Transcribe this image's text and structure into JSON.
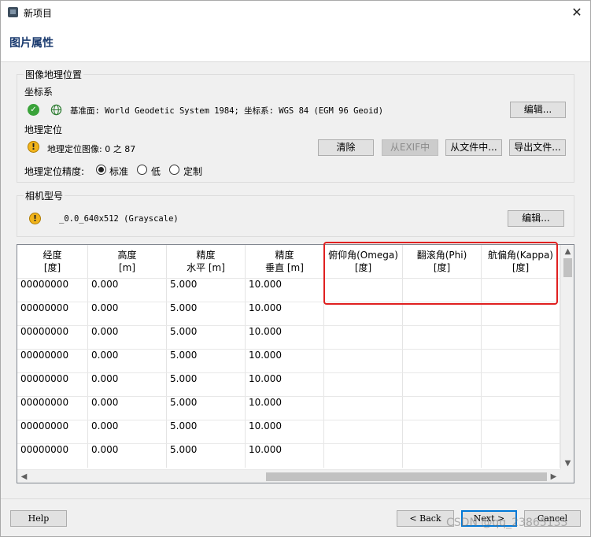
{
  "window": {
    "title": "新项目",
    "close_glyph": "✕"
  },
  "header": {
    "title": "图片属性"
  },
  "geolocation": {
    "legend": "图像地理位置",
    "coord_system_label": "坐标系",
    "coord_system_text": "基准面: World Geodetic System 1984; 坐标系: WGS 84 (EGM 96 Geoid)",
    "edit_label": "编辑...",
    "geo_label": "地理定位",
    "geo_images_text": "地理定位图像: 0 之 87",
    "clear_label": "清除",
    "from_exif_label": "从EXIF中",
    "from_file_label": "从文件中...",
    "export_file_label": "导出文件...",
    "accuracy_label": "地理定位精度:",
    "accuracy_options": [
      "标准",
      "低",
      "定制"
    ],
    "accuracy_selected": "标准"
  },
  "camera": {
    "legend": "相机型号",
    "model_text": "_0.0_640x512 (Grayscale)",
    "edit_label": "编辑..."
  },
  "table": {
    "columns": [
      {
        "line1": "经度",
        "line2": "[度]"
      },
      {
        "line1": "高度",
        "line2": "[m]"
      },
      {
        "line1": "精度",
        "line2": "水平 [m]"
      },
      {
        "line1": "精度",
        "line2": "垂直 [m]"
      },
      {
        "line1": "俯仰角(Omega)",
        "line2": "[度]"
      },
      {
        "line1": "翻滚角(Phi)",
        "line2": "[度]"
      },
      {
        "line1": "航偏角(Kappa)",
        "line2": "[度]"
      }
    ],
    "rows": [
      [
        "00000000",
        "0.000",
        "5.000",
        "10.000",
        "",
        "",
        ""
      ],
      [
        "00000000",
        "0.000",
        "5.000",
        "10.000",
        "",
        "",
        ""
      ],
      [
        "00000000",
        "0.000",
        "5.000",
        "10.000",
        "",
        "",
        ""
      ],
      [
        "00000000",
        "0.000",
        "5.000",
        "10.000",
        "",
        "",
        ""
      ],
      [
        "00000000",
        "0.000",
        "5.000",
        "10.000",
        "",
        "",
        ""
      ],
      [
        "00000000",
        "0.000",
        "5.000",
        "10.000",
        "",
        "",
        ""
      ],
      [
        "00000000",
        "0.000",
        "5.000",
        "10.000",
        "",
        "",
        ""
      ],
      [
        "00000000",
        "0.000",
        "5.000",
        "10.000",
        "",
        "",
        ""
      ]
    ]
  },
  "footer": {
    "help_label": "Help",
    "back_label": "< Back",
    "next_label": "Next >",
    "cancel_label": "Cancel",
    "watermark": "CSDN @qq_23865133"
  },
  "colors": {
    "highlight": "#e02020",
    "ok": "#3aa33a",
    "warn": "#f1b41b"
  }
}
